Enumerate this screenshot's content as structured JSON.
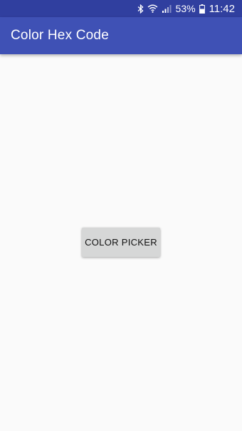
{
  "status_bar": {
    "icons": [
      "bluetooth-icon",
      "wifi-icon",
      "signal-icon",
      "battery-icon"
    ],
    "battery_percent": "53%",
    "time": "11:42"
  },
  "app_bar": {
    "title": "Color Hex Code"
  },
  "main": {
    "button_label": "COLOR PICKER"
  },
  "colors": {
    "status_bar": "#303f9f",
    "app_bar": "#3f51b5",
    "background": "#fafafa",
    "button": "#d6d7d7"
  }
}
